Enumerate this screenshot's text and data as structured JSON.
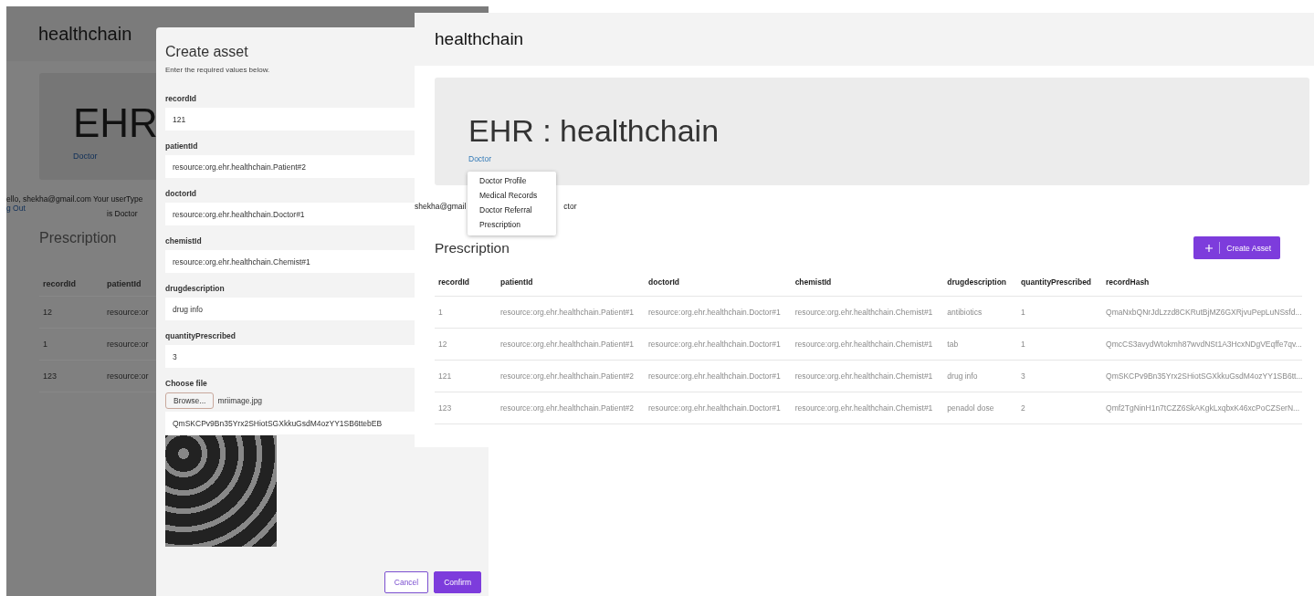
{
  "left_screenshot": {
    "page": {
      "brand": "healthchain",
      "jumbotron_title": "EHR",
      "role_link": "Doctor",
      "greeting": "ello, shekha@gmail.com Your userType",
      "logout_link": "g Out",
      "user_type": "is Doctor",
      "section_title": "Prescription",
      "table": {
        "columns": [
          "recordId",
          "patientId"
        ],
        "rows": [
          [
            "12",
            "resource:or"
          ],
          [
            "1",
            "resource:or"
          ],
          [
            "123",
            "resource:or"
          ]
        ]
      }
    },
    "modal": {
      "title": "Create asset",
      "subtitle": "Enter the required values below.",
      "fields": [
        {
          "label": "recordId",
          "value": "121"
        },
        {
          "label": "patientId",
          "value": "resource:org.ehr.healthchain.Patient#2"
        },
        {
          "label": "doctorId",
          "value": "resource:org.ehr.healthchain.Doctor#1"
        },
        {
          "label": "chemistId",
          "value": "resource:org.ehr.healthchain.Chemist#1"
        },
        {
          "label": "drugdescription",
          "value": "drug info"
        },
        {
          "label": "quantityPrescribed",
          "value": "3"
        }
      ],
      "file": {
        "label": "Choose file",
        "button": "Browse...",
        "file_name": "mriimage.jpg",
        "hash": "QmSKCPv9Bn35Yrx2SHiotSGXkkuGsdM4ozYY1SB6ttebEB"
      },
      "buttons": [
        {
          "label": "Cancel",
          "kind": "secondary"
        },
        {
          "label": "Confirm",
          "kind": "primary"
        }
      ]
    }
  },
  "right_screenshot": {
    "brand": "healthchain",
    "jumbotron_title": "EHR : healthchain",
    "role_link": "Doctor",
    "dropdown": [
      "Doctor Profile",
      "Medical Records",
      "Doctor Referral",
      "Prescription"
    ],
    "greeting_start": "shekha@gmail",
    "greeting_end": "ctor",
    "section_title": "Prescription",
    "create_button": "Create Asset",
    "table": {
      "columns": [
        "recordId",
        "patientId",
        "doctorId",
        "chemistId",
        "drugdescription",
        "quantityPrescribed",
        "recordHash"
      ],
      "rows": [
        [
          "1",
          "resource:org.ehr.healthchain.Patient#1",
          "resource:org.ehr.healthchain.Doctor#1",
          "resource:org.ehr.healthchain.Chemist#1",
          "antibiotics",
          "1",
          "QmaNxbQNrJdLzzd8CKRutBjMZ6GXRjvuPepLuNSsfd..."
        ],
        [
          "12",
          "resource:org.ehr.healthchain.Patient#1",
          "resource:org.ehr.healthchain.Doctor#1",
          "resource:org.ehr.healthchain.Chemist#1",
          "tab",
          "1",
          "QmcCS3avydWtokmh87wvdNSt1A3HcxNDgVEqffe7qv..."
        ],
        [
          "121",
          "resource:org.ehr.healthchain.Patient#2",
          "resource:org.ehr.healthchain.Doctor#1",
          "resource:org.ehr.healthchain.Chemist#1",
          "drug info",
          "3",
          "QmSKCPv9Bn35Yrx2SHiotSGXkkuGsdM4ozYY1SB6tt..."
        ],
        [
          "123",
          "resource:org.ehr.healthchain.Patient#2",
          "resource:org.ehr.healthchain.Doctor#1",
          "resource:org.ehr.healthchain.Chemist#1",
          "penadol dose",
          "2",
          "Qmf2TgNinH1n7tCZZ6SkAKgkLxqbxK46xcPoCZSerN..."
        ]
      ]
    }
  }
}
